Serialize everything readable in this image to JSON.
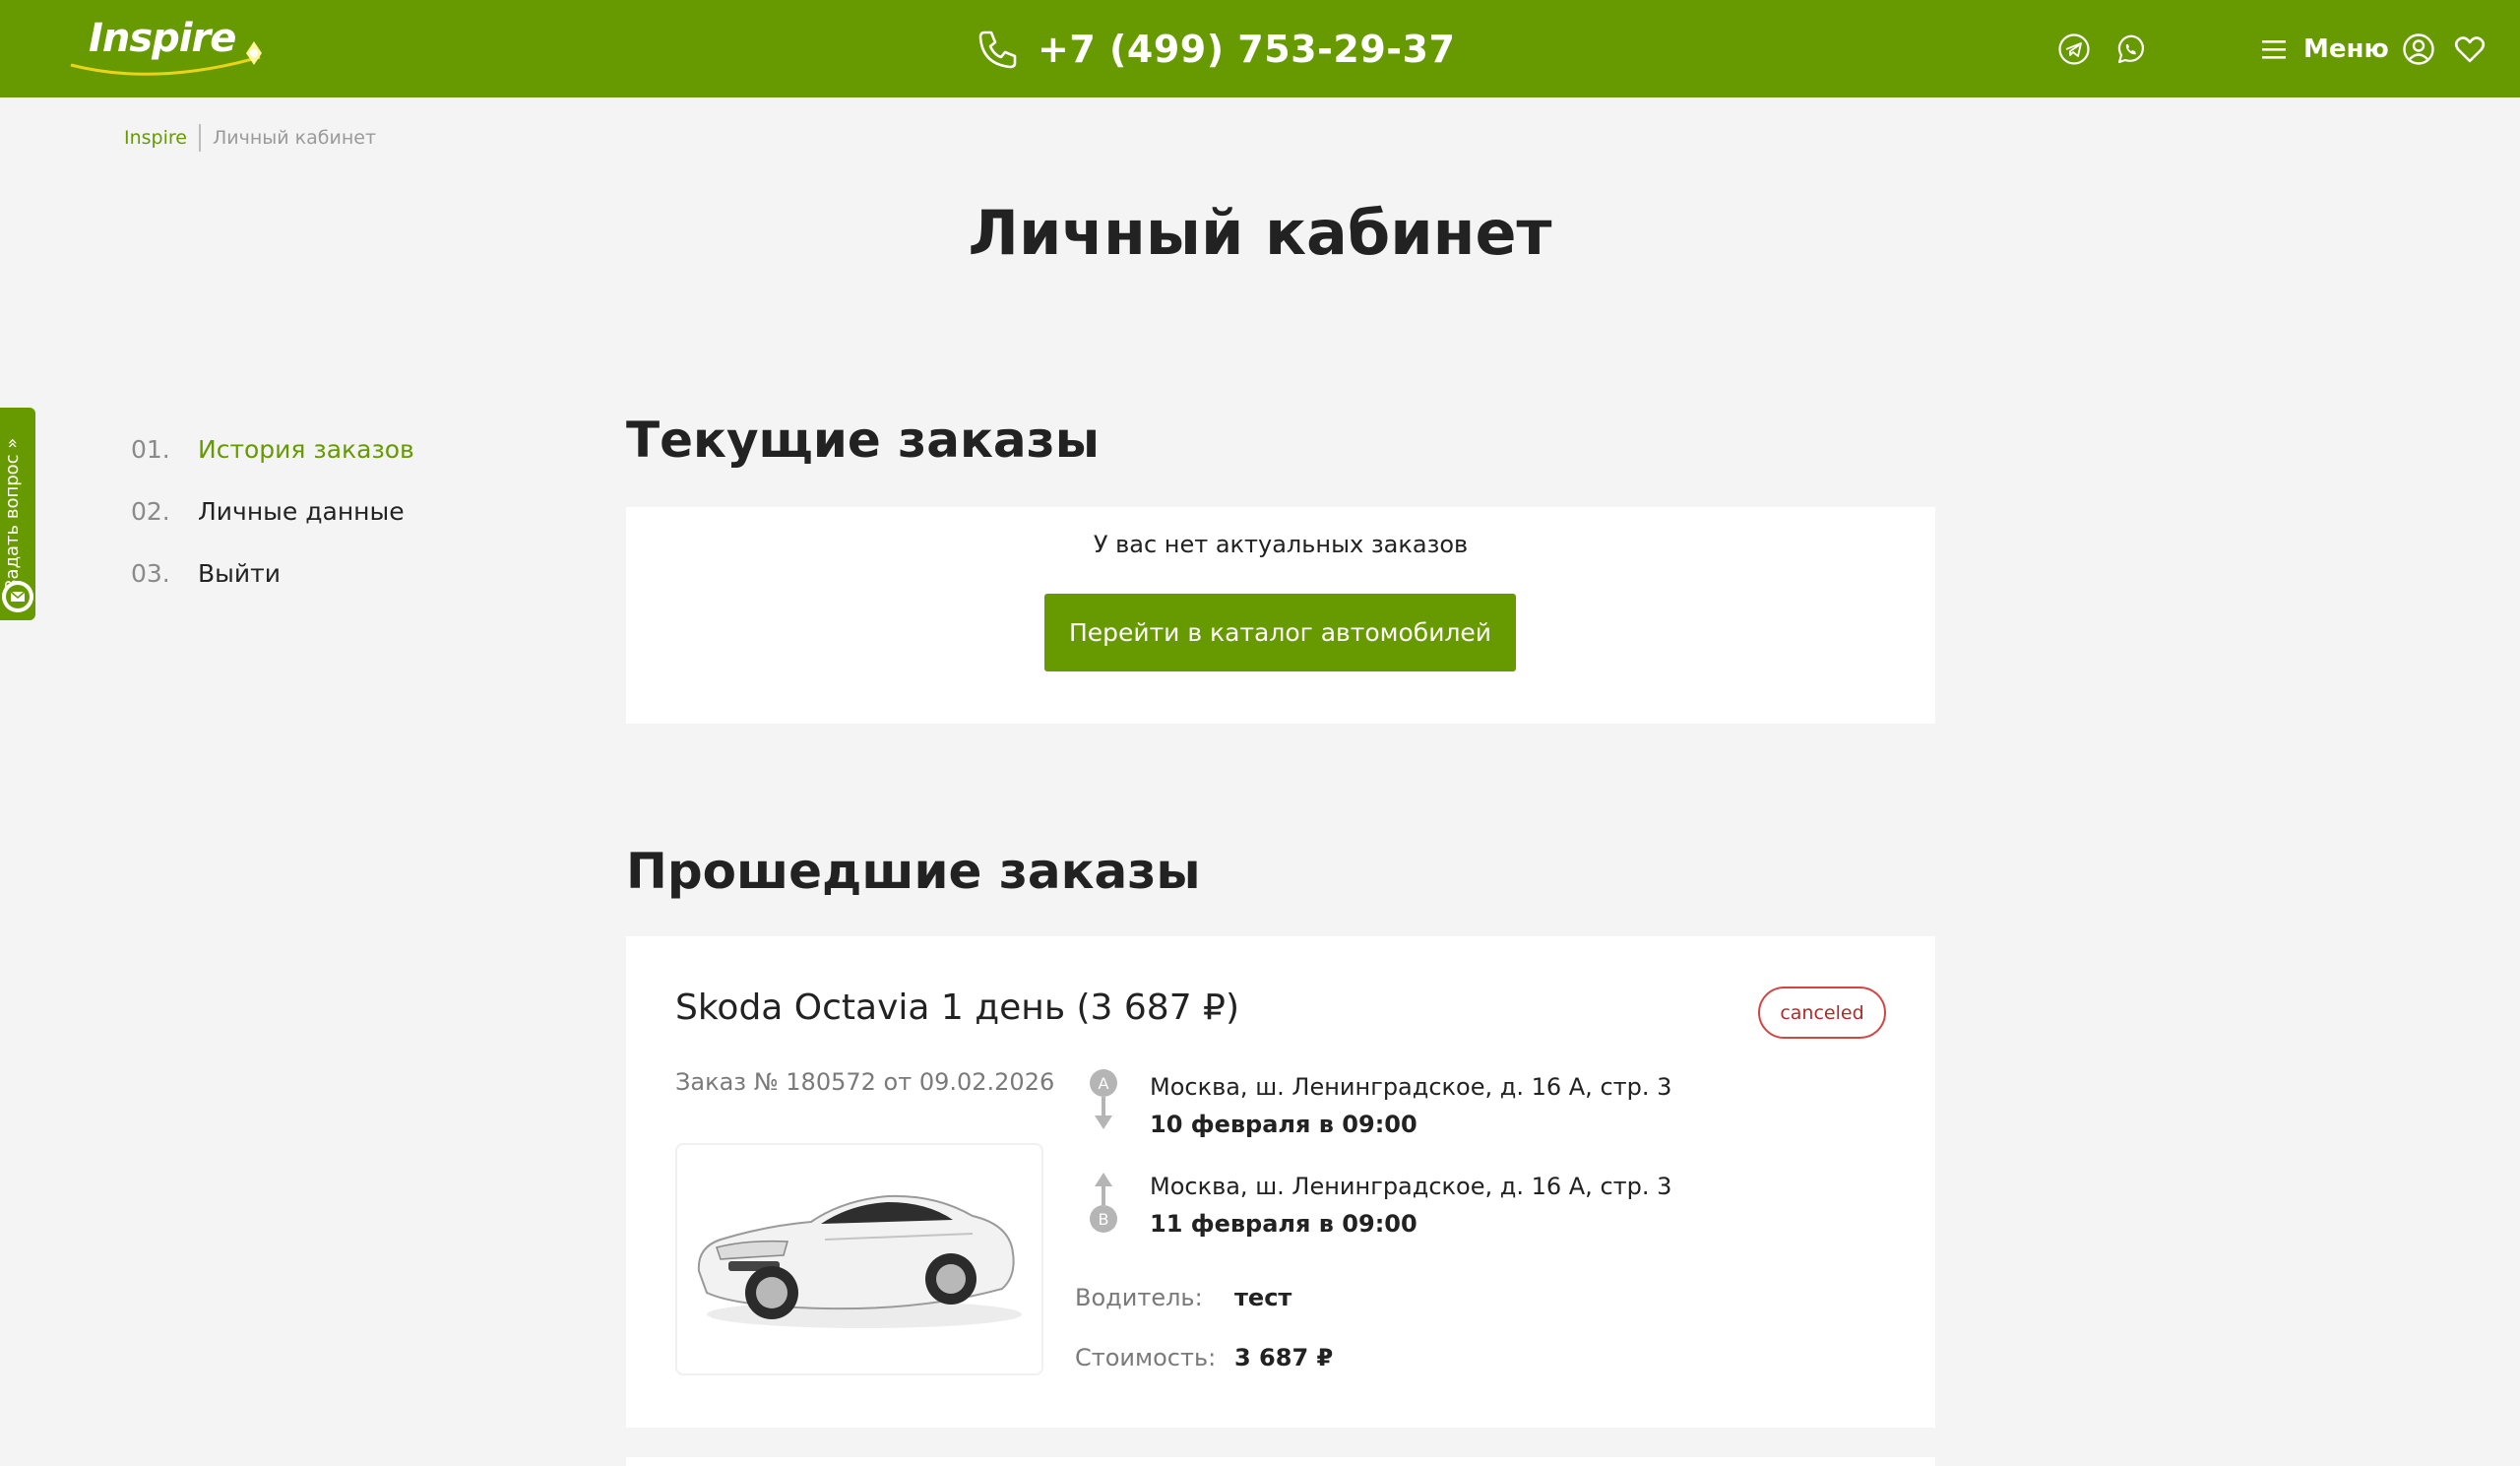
{
  "header": {
    "logo_text": "Inspire",
    "phone": "+7 (499) 753-29-37",
    "menu_label": "Меню",
    "icons": [
      "telegram-icon",
      "whatsapp-icon",
      "hamburger-icon",
      "user-icon",
      "heart-icon"
    ]
  },
  "breadcrumb": {
    "home": "Inspire",
    "current": "Личный кабинет"
  },
  "page_title": "Личный кабинет",
  "side_tab": {
    "label": "Задать вопрос »"
  },
  "nav": {
    "items": [
      {
        "num": "01.",
        "label": "История заказов",
        "active": true
      },
      {
        "num": "02.",
        "label": "Личные данные",
        "active": false
      },
      {
        "num": "03.",
        "label": "Выйти",
        "active": false
      }
    ]
  },
  "current_orders": {
    "title": "Текущие заказы",
    "empty_text": "У вас нет актуальных заказов",
    "button_label": "Перейти в каталог автомобилей"
  },
  "past_orders": {
    "title": "Прошедшие заказы",
    "orders": [
      {
        "title": "Skoda Octavia 1 день (3 687 ₽)",
        "status": "canceled",
        "meta": "Заказ № 180572 от 09.02.2026",
        "pickup": {
          "marker": "A",
          "address": "Москва, ш. Ленинградское, д. 16 А, стр. 3",
          "time": "10 февраля в 09:00"
        },
        "return": {
          "marker": "B",
          "address": "Москва, ш. Ленинградское, д. 16 А, стр. 3",
          "time": "11 февраля в 09:00"
        },
        "driver_label": "Водитель:",
        "driver_value": "тест",
        "cost_label": "Стоимость:",
        "cost_value": "3 687 ₽"
      }
    ]
  },
  "colors": {
    "brand_green": "#669a00",
    "status_canceled": "#d24545",
    "background": "#f4f4f4"
  }
}
